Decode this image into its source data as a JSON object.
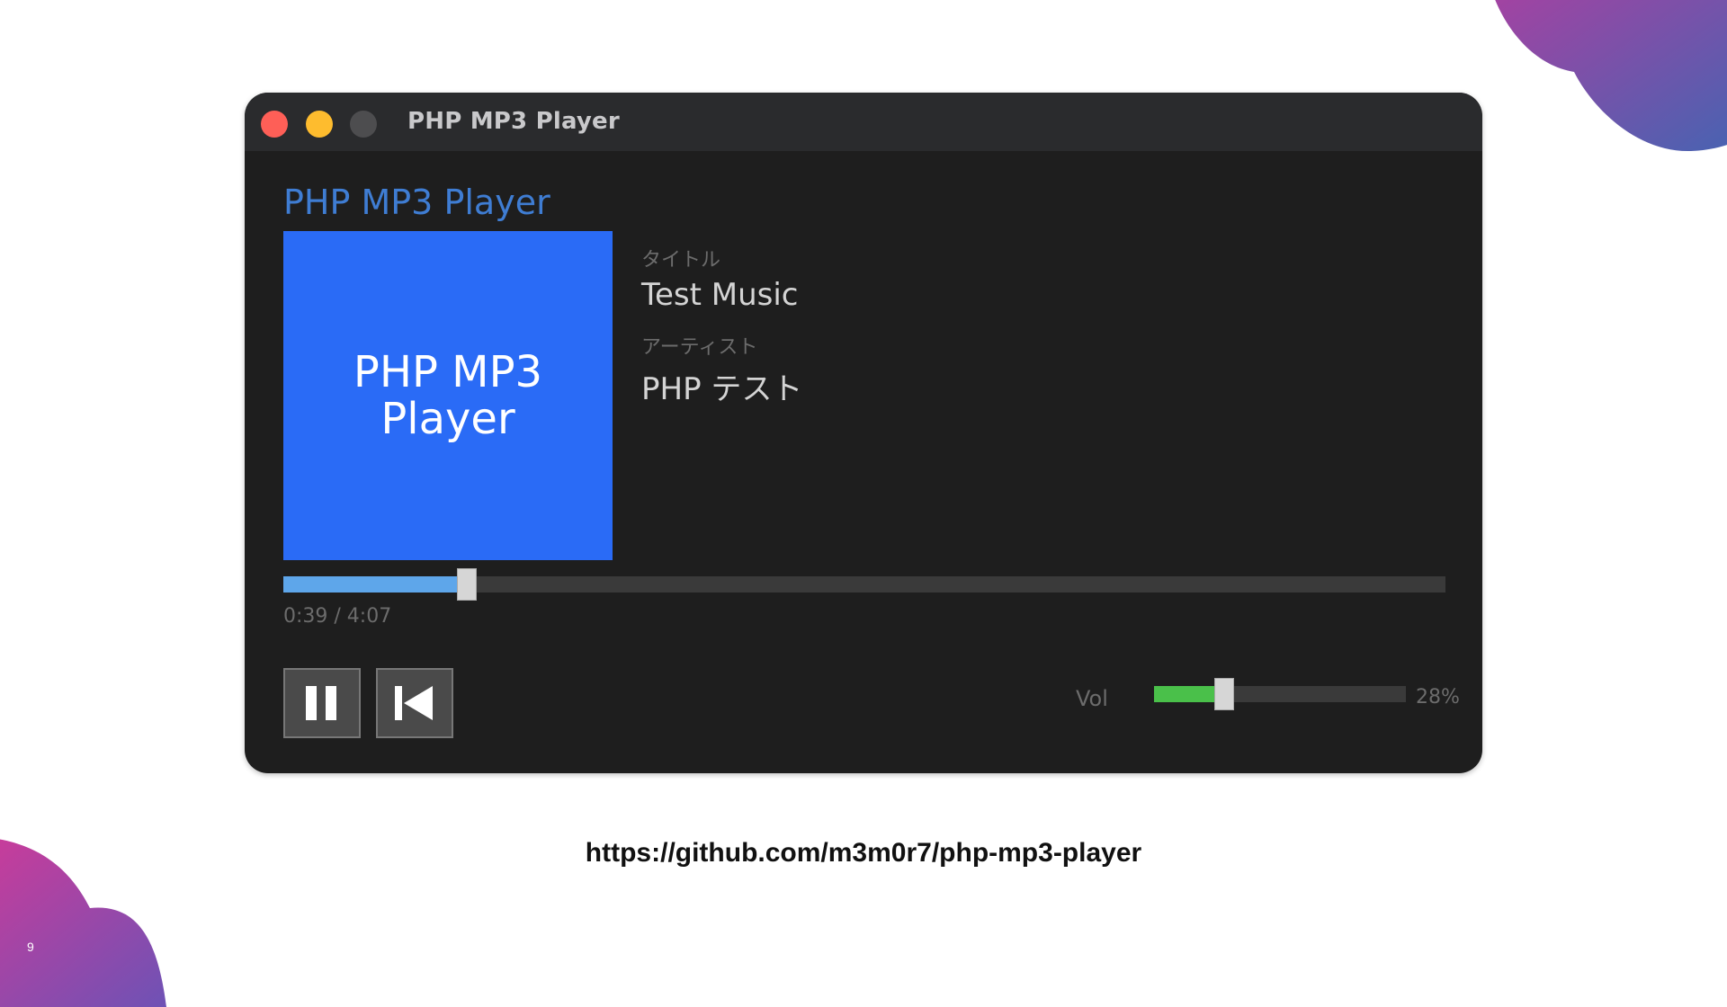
{
  "window": {
    "title": "PHP MP3 Player"
  },
  "player": {
    "heading": "PHP MP3 Player",
    "cover": {
      "text": "PHP MP3 Player",
      "color": "#2a6bf6"
    },
    "metadata": {
      "title_label": "タイトル",
      "title_value": "Test Music",
      "artist_label": "アーティスト",
      "artist_value": "PHP テスト"
    },
    "progress": {
      "time_text": "0:39 / 4:07",
      "fraction": 0.158
    },
    "controls": {
      "pause_icon": "pause-icon",
      "previous_icon": "skip-previous-icon"
    },
    "volume": {
      "label": "Vol",
      "percent_text": "28%",
      "level": 0.28
    }
  },
  "colors": {
    "accent_blue": "#3f7dd3",
    "progress_fill": "#5ea6ea",
    "volume_fill": "#4ac04a",
    "close_button": "#fe5f57",
    "minimize_button": "#febc2e",
    "zoom_button_inactive": "#4d4d4f"
  },
  "slide": {
    "url": "https://github.com/m3m0r7/php-mp3-player",
    "page_number": "9"
  }
}
